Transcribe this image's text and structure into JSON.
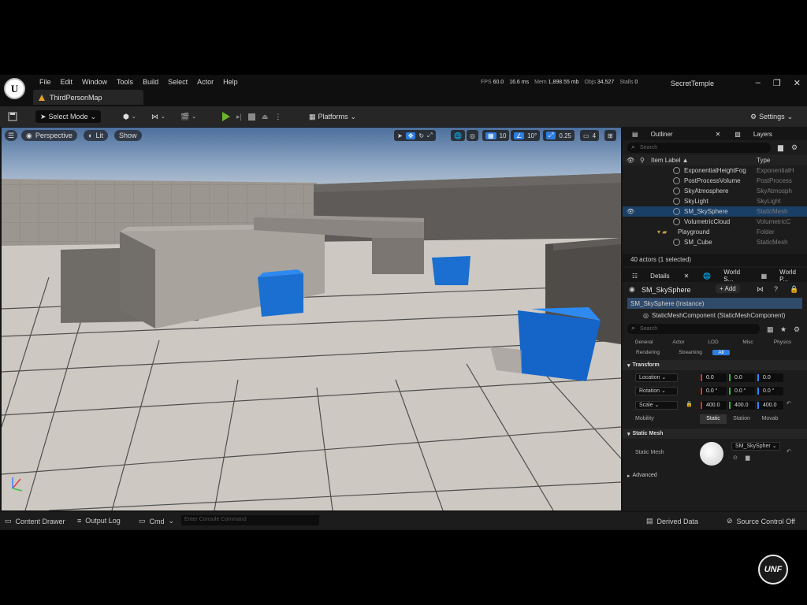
{
  "menu": [
    "File",
    "Edit",
    "Window",
    "Tools",
    "Build",
    "Select",
    "Actor",
    "Help"
  ],
  "map_tab": "ThirdPersonMap",
  "stats": {
    "fps_label": "FPS",
    "fps": "60.0",
    "ms": "16.6 ms",
    "mem_label": "Mem",
    "mem": "1,898.55 mb",
    "objs_label": "Objs",
    "objs": "34,527",
    "stalls_label": "Stalls",
    "stalls": "0"
  },
  "project_name": "SecretTemple",
  "window_buttons": [
    "–",
    "❐",
    "✕"
  ],
  "toolbar": {
    "select_mode": "Select Mode",
    "platforms": "Platforms",
    "settings": "Settings"
  },
  "viewport": {
    "perspective": "Perspective",
    "lit": "Lit",
    "show": "Show",
    "grid_snap": "10",
    "rot_snap": "10°",
    "scale_snap": "0.25",
    "camera_speed": "4"
  },
  "outliner": {
    "tab": "Outliner",
    "tab2": "Layers",
    "search_placeholder": "Search",
    "col_label": "Item Label ▲",
    "col_type": "Type",
    "items": [
      {
        "label": "ExponentialHeightFog",
        "type": "ExponentialH"
      },
      {
        "label": "PostProcessVolume",
        "type": "PostProcess"
      },
      {
        "label": "SkyAtmosphere",
        "type": "SkyAtmosph"
      },
      {
        "label": "SkyLight",
        "type": "SkyLight"
      },
      {
        "label": "SM_SkySphere",
        "type": "StaticMesh"
      },
      {
        "label": "VolumetricCloud",
        "type": "VolumetricC"
      },
      {
        "label": "Playground",
        "type": "Folder"
      },
      {
        "label": "SM_Cube",
        "type": "StaticMesh"
      }
    ],
    "footer": "40 actors (1 selected)"
  },
  "details": {
    "tabs": [
      "Details",
      "World S...",
      "World P..."
    ],
    "actor_name": "SM_SkySphere",
    "add": "+ Add",
    "instance": "SM_SkySphere (Instance)",
    "component": "StaticMeshComponent (StaticMeshComponent)",
    "search_placeholder": "Search",
    "filters": [
      "General",
      "Actor",
      "LOD",
      "Misc",
      "Physics",
      "Rendering",
      "Streaming",
      "All"
    ],
    "transform_header": "Transform",
    "location_label": "Location",
    "location": [
      "0.0",
      "0.0",
      "0.0"
    ],
    "rotation_label": "Rotation",
    "rotation": [
      "0.0 °",
      "0.0 °",
      "0.0 °"
    ],
    "scale_label": "Scale",
    "scale": [
      "400.0",
      "400.0",
      "400.0"
    ],
    "mobility_label": "Mobility",
    "mobility": [
      "Static",
      "Station",
      "Movab"
    ],
    "static_mesh_header": "Static Mesh",
    "static_mesh_label": "Static Mesh",
    "static_mesh_value": "SM_SkySpher",
    "advanced": "Advanced"
  },
  "statusbar": {
    "content_drawer": "Content Drawer",
    "output_log": "Output Log",
    "cmd": "Cmd",
    "console_placeholder": "Enter Console Command",
    "derived_data": "Derived Data",
    "source_control": "Source Control Off"
  },
  "watermark": "UNF"
}
